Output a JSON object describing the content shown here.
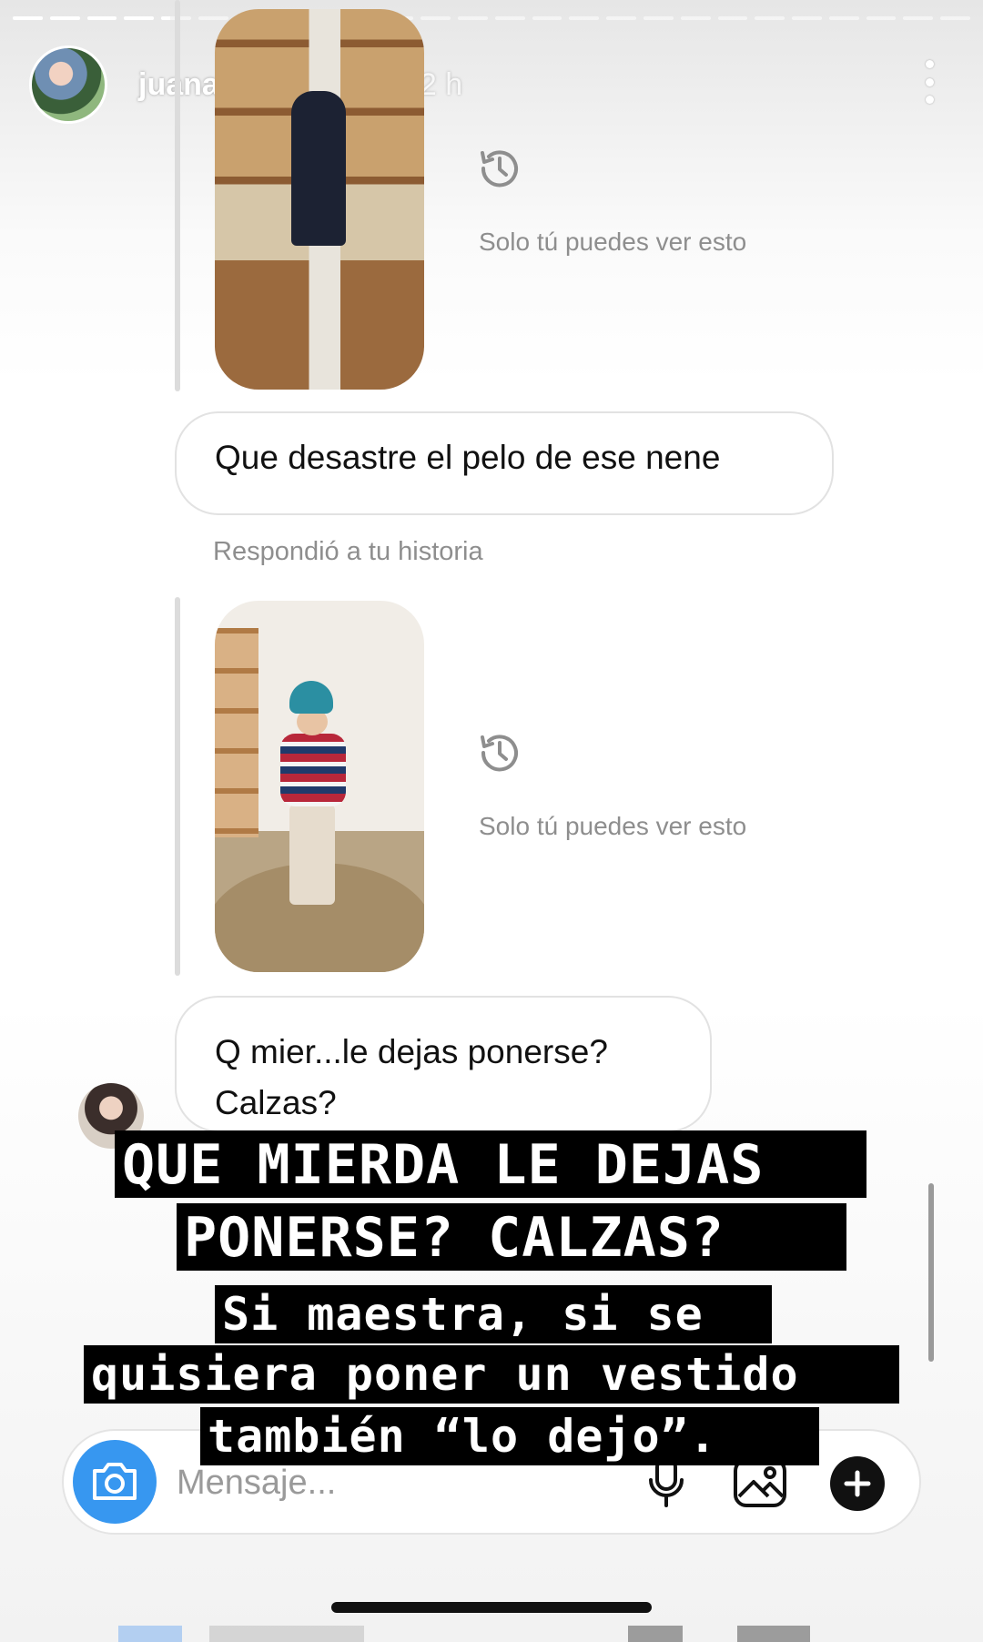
{
  "story": {
    "username": "juanarepettook",
    "time_ago": "22 h",
    "progress_segments": [
      1,
      1,
      1,
      1,
      0.3,
      0,
      0,
      0,
      0,
      0,
      0,
      0,
      0,
      0,
      0,
      0,
      0,
      0,
      0,
      0,
      0,
      0,
      0,
      0,
      0,
      0
    ]
  },
  "chat": {
    "only_you_1": "Solo tú puedes ver esto",
    "message_1": "Que desastre el pelo de ese nene",
    "replied_label": "Respondió a tu historia",
    "only_you_2": "Solo tú puedes ver esto",
    "message_2_line1": "Q mier...le dejas ponerse?",
    "message_2_line2": "Calzas?"
  },
  "overlay": {
    "line1": "QUE MIERDA LE DEJAS",
    "line2": "PONERSE? CALZAS?",
    "line3": "Si maestra, si se",
    "line4": "quisiera poner un vestido",
    "line5": "también “lo dejo”."
  },
  "composer": {
    "placeholder": "Mensaje...",
    "icons": [
      "camera-icon",
      "microphone-icon",
      "gallery-icon",
      "plus-icon"
    ],
    "camera_color": "#3797f0"
  }
}
